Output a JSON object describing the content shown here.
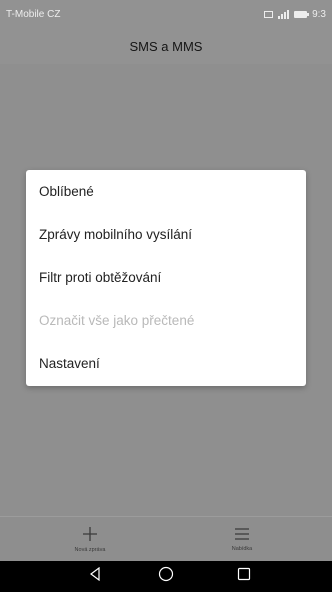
{
  "status_bar": {
    "carrier": "T-Mobile CZ",
    "time": "9:3",
    "icons": [
      "sim-icon",
      "signal-icon",
      "battery-icon"
    ]
  },
  "header": {
    "title": "SMS a MMS"
  },
  "menu": {
    "items": [
      {
        "label": "Oblíbené",
        "enabled": true
      },
      {
        "label": "Zprávy mobilního vysílání",
        "enabled": true
      },
      {
        "label": "Filtr proti obtěžování",
        "enabled": true
      },
      {
        "label": "Označit vše jako přečtené",
        "enabled": false
      },
      {
        "label": "Nastavení",
        "enabled": true
      }
    ]
  },
  "bottom_bar": {
    "new_message": {
      "label": "Nová zpráva",
      "icon": "plus-icon"
    },
    "menu": {
      "label": "Nabídka",
      "icon": "hamburger-menu-icon"
    }
  },
  "nav_bar": {
    "icons": [
      "back-icon",
      "home-icon",
      "recent-apps-icon"
    ]
  },
  "colors": {
    "dim_overlay": "#8f8f8f",
    "dialog_bg": "#ffffff",
    "disabled_text": "#b9b9b9"
  }
}
